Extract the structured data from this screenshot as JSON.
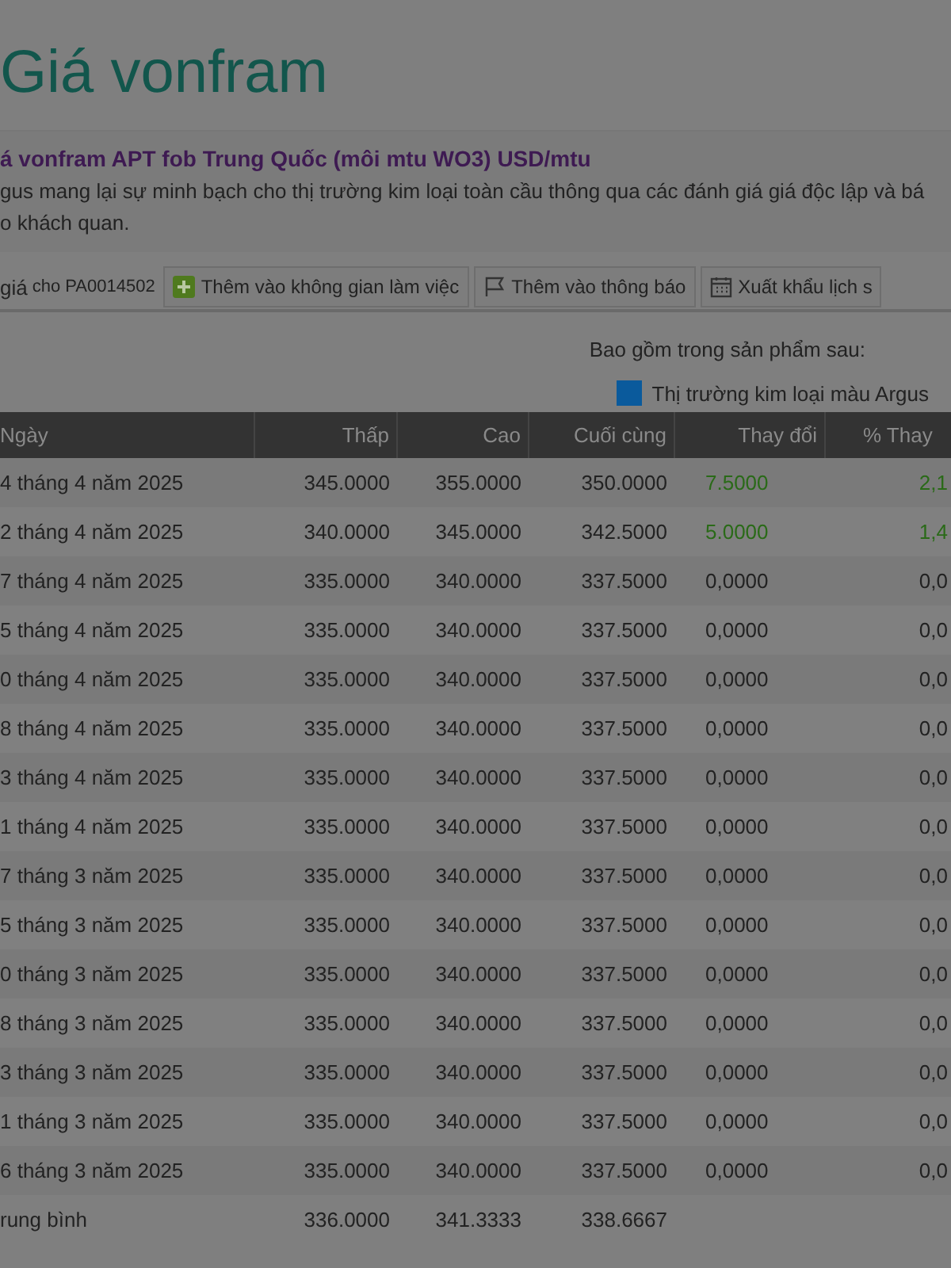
{
  "page_title": "Giá vonfram",
  "section": {
    "subtitle": "á vonfram APT fob Trung Quốc (môi mtu WO3) USD/mtu",
    "description_lines": [
      "gus mang lại sự minh bạch cho thị trường kim loại toàn cầu thông qua các đánh giá giá độc lập và bá",
      "o khách quan."
    ]
  },
  "toolbar": {
    "label": "giá",
    "code": "cho PA0014502",
    "buttons": [
      {
        "kind": "add",
        "label": "Thêm vào không gian làm việc"
      },
      {
        "kind": "alert",
        "label": "Thêm vào thông báo"
      },
      {
        "kind": "export",
        "label": "Xuất khẩu lịch s"
      }
    ]
  },
  "included_in": {
    "label": "Bao gồm trong sản phẩm sau:",
    "products": [
      {
        "name": "Thị trường kim loại màu Argus",
        "color": "#0a5a9c"
      }
    ]
  },
  "table": {
    "columns": [
      "Ngày",
      "Thấp",
      "Cao",
      "Cuối cùng",
      "Thay đổi",
      "% Thay"
    ],
    "rows": [
      {
        "date": "4 tháng 4 năm 2025",
        "low": "345.0000",
        "high": "355.0000",
        "last": "350.0000",
        "change": "7.5000",
        "pct": "2,1",
        "color": "#2a6a18"
      },
      {
        "date": "2 tháng 4 năm 2025",
        "low": "340.0000",
        "high": "345.0000",
        "last": "342.5000",
        "change": "5.0000",
        "pct": "1,4",
        "color": "#2a6a18"
      },
      {
        "date": "7 tháng 4 năm 2025",
        "low": "335.0000",
        "high": "340.0000",
        "last": "337.5000",
        "change": "0,0000",
        "pct": "0,0"
      },
      {
        "date": "5 tháng 4 năm 2025",
        "low": "335.0000",
        "high": "340.0000",
        "last": "337.5000",
        "change": "0,0000",
        "pct": "0,0"
      },
      {
        "date": "0 tháng 4 năm 2025",
        "low": "335.0000",
        "high": "340.0000",
        "last": "337.5000",
        "change": "0,0000",
        "pct": "0,0"
      },
      {
        "date": "8 tháng 4 năm 2025",
        "low": "335.0000",
        "high": "340.0000",
        "last": "337.5000",
        "change": "0,0000",
        "pct": "0,0"
      },
      {
        "date": "3 tháng 4 năm 2025",
        "low": "335.0000",
        "high": "340.0000",
        "last": "337.5000",
        "change": "0,0000",
        "pct": "0,0"
      },
      {
        "date": "1 tháng 4 năm 2025",
        "low": "335.0000",
        "high": "340.0000",
        "last": "337.5000",
        "change": "0,0000",
        "pct": "0,0"
      },
      {
        "date": "7 tháng 3 năm 2025",
        "low": "335.0000",
        "high": "340.0000",
        "last": "337.5000",
        "change": "0,0000",
        "pct": "0,0"
      },
      {
        "date": "5 tháng 3 năm 2025",
        "low": "335.0000",
        "high": "340.0000",
        "last": "337.5000",
        "change": "0,0000",
        "pct": "0,0"
      },
      {
        "date": "0 tháng 3 năm 2025",
        "low": "335.0000",
        "high": "340.0000",
        "last": "337.5000",
        "change": "0,0000",
        "pct": "0,0"
      },
      {
        "date": "8 tháng 3 năm 2025",
        "low": "335.0000",
        "high": "340.0000",
        "last": "337.5000",
        "change": "0,0000",
        "pct": "0,0"
      },
      {
        "date": "3 tháng 3 năm 2025",
        "low": "335.0000",
        "high": "340.0000",
        "last": "337.5000",
        "change": "0,0000",
        "pct": "0,0"
      },
      {
        "date": "1 tháng 3 năm 2025",
        "low": "335.0000",
        "high": "340.0000",
        "last": "337.5000",
        "change": "0,0000",
        "pct": "0,0"
      },
      {
        "date": "6 tháng 3 năm 2025",
        "low": "335.0000",
        "high": "340.0000",
        "last": "337.5000",
        "change": "0,0000",
        "pct": "0,0"
      }
    ],
    "average": {
      "label": "rung bình",
      "low": "336.0000",
      "high": "341.3333",
      "last": "338.6667"
    }
  }
}
